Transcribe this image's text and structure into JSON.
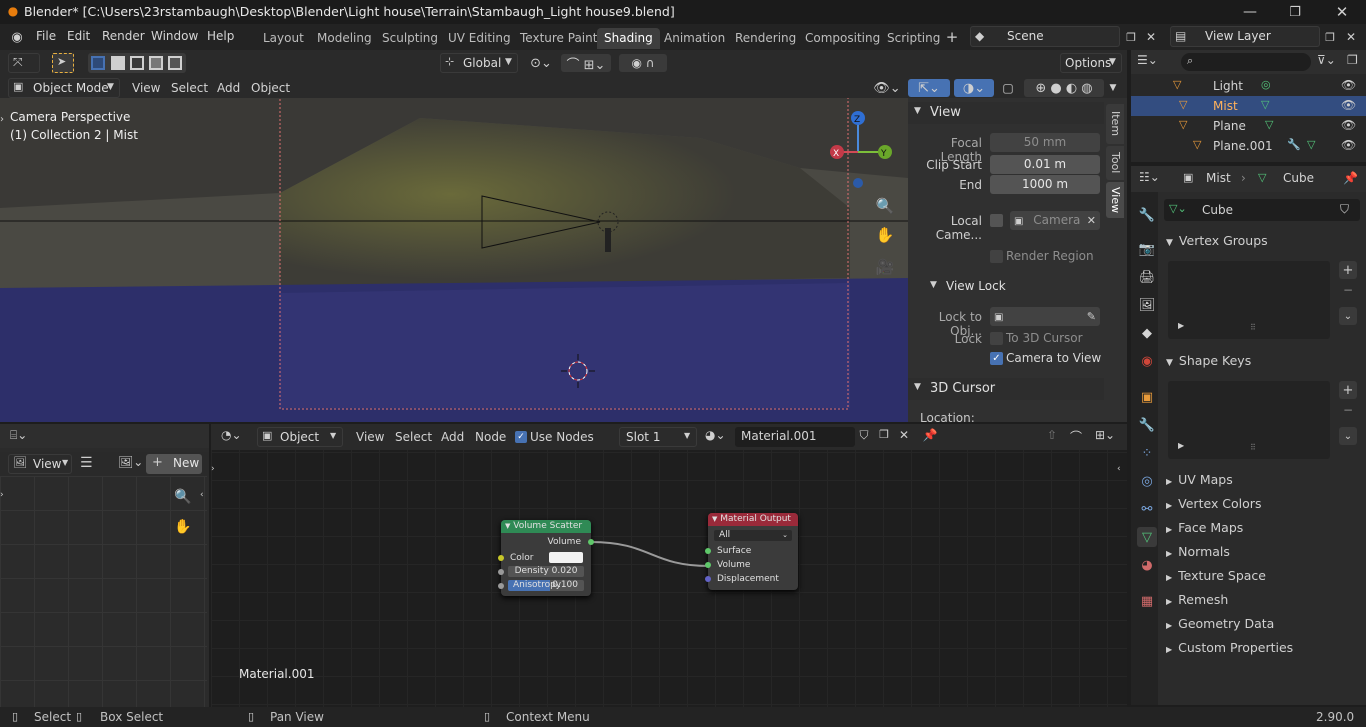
{
  "titlebar": {
    "title": "Blender* [C:\\Users\\23rstambaugh\\Desktop\\Blender\\Light house\\Terrain\\Stambaugh_Light house9.blend]"
  },
  "menu": {
    "items": [
      "File",
      "Edit",
      "Render",
      "Window",
      "Help"
    ]
  },
  "workspaces": [
    "Layout",
    "Modeling",
    "Sculpting",
    "UV Editing",
    "Texture Paint",
    "Shading",
    "Animation",
    "Rendering",
    "Compositing",
    "Scripting"
  ],
  "active_workspace": "Shading",
  "scene": "Scene",
  "view_layer": "View Layer",
  "viewport": {
    "transform_orientation": "Global",
    "options_label": "Options",
    "mode": "Object Mode",
    "menus": [
      "View",
      "Select",
      "Add",
      "Object"
    ],
    "overlay_line1": "Camera Perspective",
    "overlay_line2": "(1) Collection 2 | Mist",
    "gizmo": {
      "z": "Z",
      "y": "Y",
      "x": "X"
    }
  },
  "npanel": {
    "tabs": [
      "Item",
      "Tool",
      "View"
    ],
    "view_header": "View",
    "focal_length_label": "Focal Length",
    "focal_length": "50 mm",
    "clip_start_label": "Clip Start",
    "clip_start": "0.01 m",
    "end_label": "End",
    "end": "1000 m",
    "local_camera_label": "Local Came...",
    "local_camera": "Camera",
    "render_region": "Render Region",
    "view_lock_header": "View Lock",
    "lock_to_obj_label": "Lock to Obj...",
    "lock_label": "Lock",
    "to_3d_cursor": "To 3D Cursor",
    "camera_to_view": "Camera to View",
    "cursor_header": "3D Cursor",
    "location_label": "Location:"
  },
  "outliner": {
    "items": [
      {
        "name": "Light"
      },
      {
        "name": "Mist",
        "selected": true
      },
      {
        "name": "Plane"
      },
      {
        "name": "Plane.001"
      }
    ]
  },
  "properties": {
    "breadcrumb_object": "Mist",
    "breadcrumb_data": "Cube",
    "mesh_name": "Cube",
    "vertex_groups": "Vertex Groups",
    "shape_keys": "Shape Keys",
    "sections": [
      "UV Maps",
      "Vertex Colors",
      "Face Maps",
      "Normals",
      "Texture Space",
      "Remesh",
      "Geometry Data",
      "Custom Properties"
    ]
  },
  "image_editor": {
    "view_label": "View",
    "new_label": "New"
  },
  "node_editor": {
    "object_label": "Object",
    "menus": [
      "View",
      "Select",
      "Add",
      "Node"
    ],
    "use_nodes": "Use Nodes",
    "slot": "Slot 1",
    "material": "Material.001",
    "material_overlay": "Material.001",
    "volume_scatter": {
      "title": "Volume Scatter",
      "volume": "Volume",
      "color": "Color",
      "density_label": "Density",
      "density": "0.020",
      "anisotropy_label": "Anisotropy",
      "anisotropy": "0.100",
      "color_swatch": "#f2f2f2"
    },
    "material_output": {
      "title": "Material Output",
      "target": "All",
      "surface": "Surface",
      "volume": "Volume",
      "displacement": "Displacement"
    }
  },
  "statusbar": {
    "select": "Select",
    "box_select": "Box Select",
    "pan_view": "Pan View",
    "context_menu": "Context Menu",
    "version": "2.90.0"
  },
  "colors": {
    "accent": "#4772b3",
    "selected_row": "#334d80",
    "node_scatter_header": "#2f8a55",
    "node_output_header": "#9a2a3a",
    "water": "#2d2f6a"
  }
}
